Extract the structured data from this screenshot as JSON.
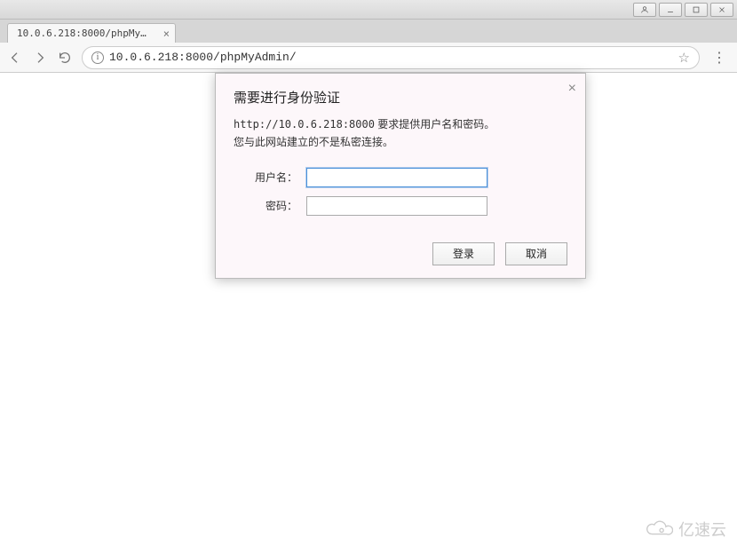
{
  "window": {
    "tab_title": "10.0.6.218:8000/phpMyAdmin"
  },
  "addressbar": {
    "url": "10.0.6.218:8000/phpMyAdmin/"
  },
  "dialog": {
    "title": "需要进行身份验证",
    "message_line1_prefix": "http://10.0.6.218:8000",
    "message_line1_suffix": " 要求提供用户名和密码。",
    "message_line2": "您与此网站建立的不是私密连接。",
    "username_label": "用户名：",
    "password_label": "密码：",
    "username_value": "",
    "password_value": "",
    "login_button": "登录",
    "cancel_button": "取消"
  },
  "watermark": {
    "text": "亿速云"
  }
}
